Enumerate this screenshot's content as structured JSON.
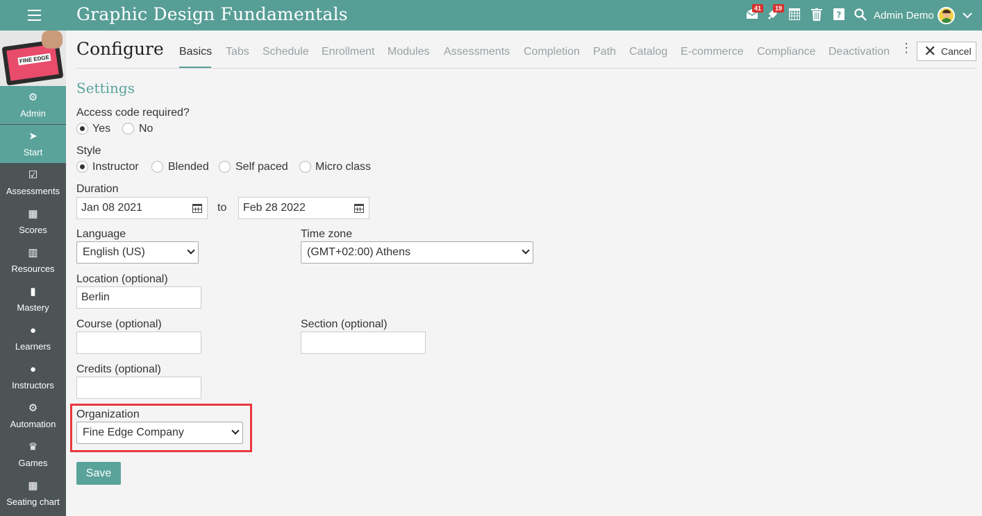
{
  "topbar": {
    "app_title": "Graphic Design Fundamentals",
    "messages_badge": "41",
    "notifications_badge": "19",
    "user_name": "Admin Demo"
  },
  "sidebar": {
    "course_thumb_text": "FINE EDGE",
    "items": [
      {
        "label": "Admin",
        "icon": "gear-icon",
        "glyph": "⚙"
      },
      {
        "label": "Start",
        "icon": "location-arrow-icon",
        "glyph": "➤"
      },
      {
        "label": "Assessments",
        "icon": "checkbox-icon",
        "glyph": "☑"
      },
      {
        "label": "Scores",
        "icon": "gradebook-icon",
        "glyph": "▦"
      },
      {
        "label": "Resources",
        "icon": "books-icon",
        "glyph": "▥"
      },
      {
        "label": "Mastery",
        "icon": "bar-chart-icon",
        "glyph": "▮"
      },
      {
        "label": "Learners",
        "icon": "user-icon",
        "glyph": "●"
      },
      {
        "label": "Instructors",
        "icon": "instructor-icon",
        "glyph": "●"
      },
      {
        "label": "Automation",
        "icon": "cogs-icon",
        "glyph": "⚙"
      },
      {
        "label": "Games",
        "icon": "trophy-icon",
        "glyph": "♛"
      },
      {
        "label": "Seating chart",
        "icon": "seating-icon",
        "glyph": "▦"
      }
    ]
  },
  "header": {
    "title": "Configure",
    "tabs": [
      "Basics",
      "Tabs",
      "Schedule",
      "Enrollment",
      "Modules",
      "Assessments",
      "Completion",
      "Path",
      "Catalog",
      "E-commerce",
      "Compliance",
      "Deactivation"
    ],
    "cancel_label": "Cancel"
  },
  "form": {
    "section_title": "Settings",
    "access_code_label": "Access code required?",
    "access_code_options": [
      "Yes",
      "No"
    ],
    "access_code_value": "Yes",
    "style_label": "Style",
    "style_options": [
      "Instructor",
      "Blended",
      "Self paced",
      "Micro class"
    ],
    "style_value": "Instructor",
    "duration_label": "Duration",
    "duration_start": "Jan 08 2021",
    "duration_to": "to",
    "duration_end": "Feb 28 2022",
    "language_label": "Language",
    "language_value": "English (US)",
    "timezone_label": "Time zone",
    "timezone_value": "(GMT+02:00) Athens",
    "location_label": "Location (optional)",
    "location_value": "Berlin",
    "course_label": "Course (optional)",
    "course_value": "",
    "section_label": "Section (optional)",
    "section_value": "",
    "credits_label": "Credits (optional)",
    "credits_value": "",
    "organization_label": "Organization",
    "organization_value": "Fine Edge Company",
    "save_label": "Save"
  },
  "colors": {
    "brand": "#579e96",
    "sidebar_bg": "#4d5456",
    "badge": "#d9302c",
    "highlight": "#e8383d"
  }
}
